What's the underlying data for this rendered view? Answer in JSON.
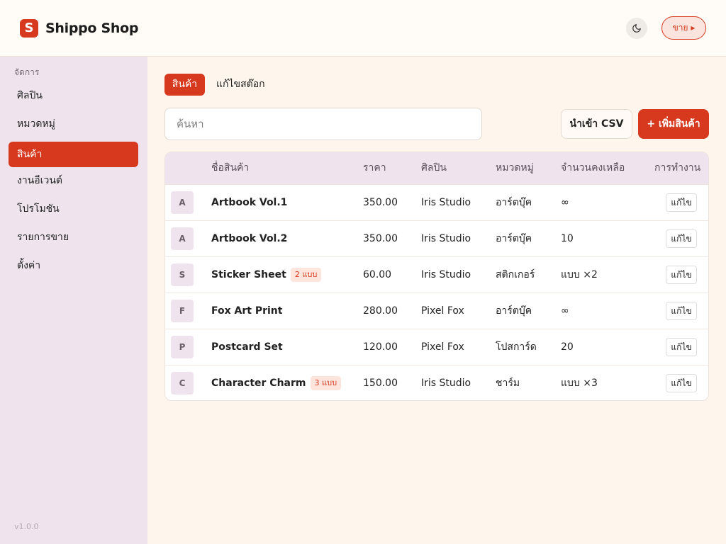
{
  "header": {
    "logo_letter": "S",
    "brand": "Shippo Shop",
    "theme_icon": "moon-icon",
    "sell_label": "ขาย ▸"
  },
  "sidebar": {
    "section": "จัดการ",
    "items": [
      {
        "label": "ศิลปิน",
        "active": false
      },
      {
        "label": "หมวดหมู่",
        "active": false
      },
      {
        "label": "สินค้า",
        "active": true
      },
      {
        "label": "งานอีเวนต์",
        "active": false
      },
      {
        "label": "โปรโมชัน",
        "active": false
      },
      {
        "label": "รายการขาย",
        "active": false
      },
      {
        "label": "ตั้งค่า",
        "active": false
      }
    ],
    "version": "v1.0.0"
  },
  "tabs": [
    {
      "label": "สินค้า",
      "active": true
    },
    {
      "label": "แก้ไขสต๊อก",
      "active": false
    }
  ],
  "search": {
    "placeholder": "ค้นหา",
    "value": ""
  },
  "toolbar": {
    "import_label": "นำเข้า CSV",
    "add_label": "+ เพิ่มสินค้า"
  },
  "colors": {
    "accent": "#d6391e",
    "sidebar_bg": "#efe4ee",
    "page_bg": "#fef6ec"
  },
  "table": {
    "headers": [
      "ชื่อสินค้า",
      "ราคา",
      "ศิลปิน",
      "หมวดหมู่",
      "จำนวนคงเหลือ",
      "การทำงาน"
    ],
    "rows": [
      {
        "thumb": "A",
        "name": "Artbook Vol.1",
        "badge": "",
        "price": "350.00",
        "artist": "Iris Studio",
        "category": "อาร์ตบุ๊ค",
        "stock": "∞",
        "action": "แก้ไข"
      },
      {
        "thumb": "A",
        "name": "Artbook Vol.2",
        "badge": "",
        "price": "350.00",
        "artist": "Iris Studio",
        "category": "อาร์ตบุ๊ค",
        "stock": "10",
        "action": "แก้ไข"
      },
      {
        "thumb": "S",
        "name": "Sticker Sheet",
        "badge": "2 แบบ",
        "price": "60.00",
        "artist": "Iris Studio",
        "category": "สติกเกอร์",
        "stock": "แบบ ×2",
        "action": "แก้ไข"
      },
      {
        "thumb": "F",
        "name": "Fox Art Print",
        "badge": "",
        "price": "280.00",
        "artist": "Pixel Fox",
        "category": "อาร์ตบุ๊ค",
        "stock": "∞",
        "action": "แก้ไข"
      },
      {
        "thumb": "P",
        "name": "Postcard Set",
        "badge": "",
        "price": "120.00",
        "artist": "Pixel Fox",
        "category": "โปสการ์ด",
        "stock": "20",
        "action": "แก้ไข"
      },
      {
        "thumb": "C",
        "name": "Character Charm",
        "badge": "3 แบบ",
        "price": "150.00",
        "artist": "Iris Studio",
        "category": "ชาร์ม",
        "stock": "แบบ ×3",
        "action": "แก้ไข"
      }
    ]
  }
}
